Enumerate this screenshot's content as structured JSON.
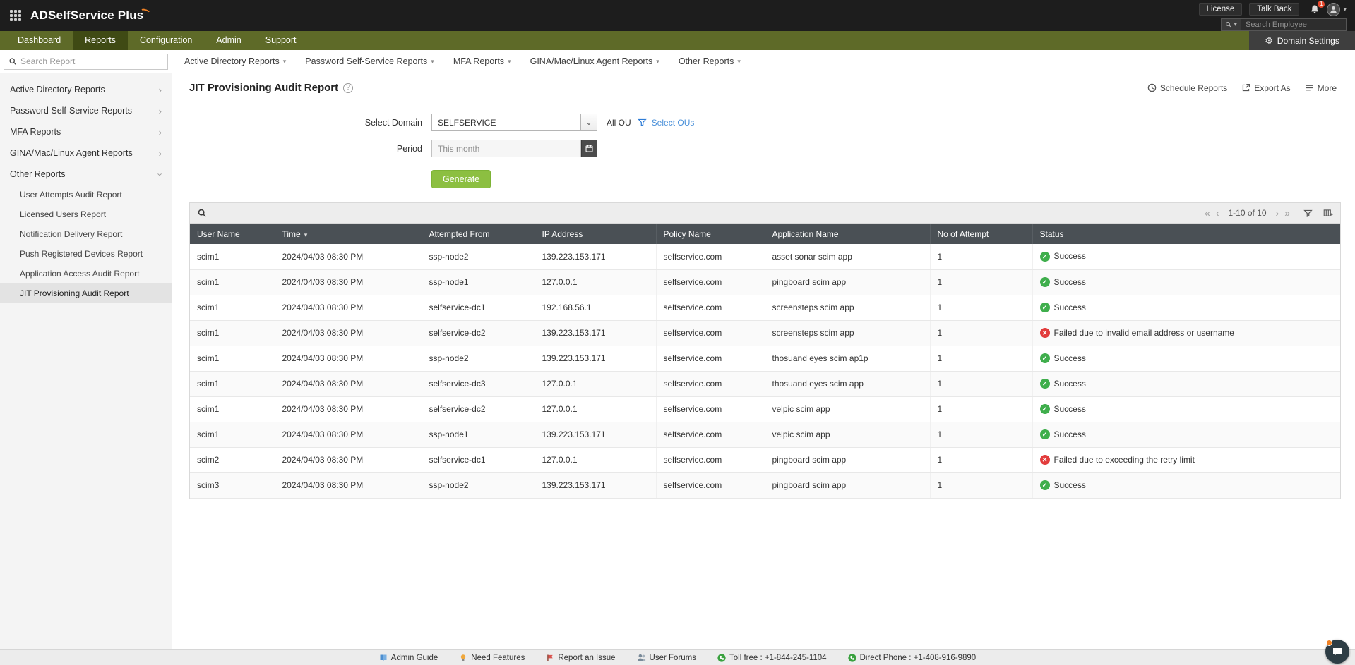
{
  "colors": {
    "header_bg": "#1d1d1d",
    "nav_bar_olive": "#5e6a28",
    "nav_active_tab": "#3f4a14",
    "accent_green": "#8cbf41",
    "link_blue": "#4a90d9",
    "success_green": "#3fae4c",
    "error_red": "#e23c3c",
    "table_header_bg": "#4a5055",
    "logo_swoosh_orange": "#f08124"
  },
  "header": {
    "app_title": "ADSelfService Plus",
    "license_label": "License",
    "talkback_label": "Talk Back",
    "notification_count": "1",
    "employee_search_placeholder": "Search Employee"
  },
  "nav": {
    "tabs": [
      {
        "label": "Dashboard",
        "active": false
      },
      {
        "label": "Reports",
        "active": true
      },
      {
        "label": "Configuration",
        "active": false
      },
      {
        "label": "Admin",
        "active": false
      },
      {
        "label": "Support",
        "active": false
      }
    ],
    "domain_settings_label": "Domain Settings"
  },
  "subnav": {
    "report_search_placeholder": "Search Report",
    "menus": [
      {
        "label": "Active Directory Reports"
      },
      {
        "label": "Password Self-Service Reports"
      },
      {
        "label": "MFA Reports"
      },
      {
        "label": "GINA/Mac/Linux Agent Reports"
      },
      {
        "label": "Other Reports"
      }
    ]
  },
  "sidebar": {
    "groups": [
      {
        "label": "Active Directory Reports",
        "expanded": false
      },
      {
        "label": "Password Self-Service Reports",
        "expanded": false
      },
      {
        "label": "MFA Reports",
        "expanded": false
      },
      {
        "label": "GINA/Mac/Linux Agent Reports",
        "expanded": false
      },
      {
        "label": "Other Reports",
        "expanded": true,
        "items": [
          {
            "label": "User Attempts Audit Report",
            "selected": false
          },
          {
            "label": "Licensed Users Report",
            "selected": false
          },
          {
            "label": "Notification Delivery Report",
            "selected": false
          },
          {
            "label": "Push Registered Devices Report",
            "selected": false
          },
          {
            "label": "Application Access Audit Report",
            "selected": false
          },
          {
            "label": "JIT Provisioning Audit Report",
            "selected": true
          }
        ]
      }
    ]
  },
  "page": {
    "title": "JIT Provisioning Audit Report",
    "actions": [
      {
        "label": "Schedule Reports",
        "icon": "schedule-icon"
      },
      {
        "label": "Export As",
        "icon": "export-icon"
      },
      {
        "label": "More",
        "icon": "more-icon"
      }
    ]
  },
  "filters": {
    "domain_label": "Select Domain",
    "domain_value": "SELFSERVICE",
    "ou_scope_label": "All OU",
    "select_ous_label": "Select OUs",
    "period_label": "Period",
    "period_value": "This month",
    "generate_label": "Generate"
  },
  "table": {
    "pagination": "1-10 of 10",
    "sorted_column": "Time",
    "columns": [
      "User Name",
      "Time",
      "Attempted From",
      "IP Address",
      "Policy Name",
      "Application Name",
      "No of Attempt",
      "Status"
    ],
    "rows": [
      {
        "user": "scim1",
        "time": "2024/04/03 08:30 PM",
        "from": "ssp-node2",
        "ip": "139.223.153.171",
        "policy": "selfservice.com",
        "app": "asset sonar scim app",
        "attempts": "1",
        "status": "Success",
        "ok": true
      },
      {
        "user": "scim1",
        "time": "2024/04/03 08:30 PM",
        "from": "ssp-node1",
        "ip": "127.0.0.1",
        "policy": "selfservice.com",
        "app": "pingboard scim app",
        "attempts": "1",
        "status": "Success",
        "ok": true
      },
      {
        "user": "scim1",
        "time": "2024/04/03 08:30 PM",
        "from": "selfservice-dc1",
        "ip": "192.168.56.1",
        "policy": "selfservice.com",
        "app": "screensteps scim app",
        "attempts": "1",
        "status": "Success",
        "ok": true
      },
      {
        "user": "scim1",
        "time": "2024/04/03 08:30 PM",
        "from": "selfservice-dc2",
        "ip": "139.223.153.171",
        "policy": "selfservice.com",
        "app": "screensteps scim app",
        "attempts": "1",
        "status": "Failed due to invalid email address or username",
        "ok": false
      },
      {
        "user": "scim1",
        "time": "2024/04/03 08:30 PM",
        "from": "ssp-node2",
        "ip": "139.223.153.171",
        "policy": "selfservice.com",
        "app": "thosuand eyes scim ap1p",
        "attempts": "1",
        "status": "Success",
        "ok": true
      },
      {
        "user": "scim1",
        "time": "2024/04/03 08:30 PM",
        "from": "selfservice-dc3",
        "ip": "127.0.0.1",
        "policy": "selfservice.com",
        "app": "thosuand eyes scim app",
        "attempts": "1",
        "status": "Success",
        "ok": true
      },
      {
        "user": "scim1",
        "time": "2024/04/03 08:30 PM",
        "from": "selfservice-dc2",
        "ip": "127.0.0.1",
        "policy": "selfservice.com",
        "app": "velpic scim app",
        "attempts": "1",
        "status": "Success",
        "ok": true
      },
      {
        "user": "scim1",
        "time": "2024/04/03 08:30 PM",
        "from": "ssp-node1",
        "ip": "139.223.153.171",
        "policy": "selfservice.com",
        "app": "velpic scim app",
        "attempts": "1",
        "status": "Success",
        "ok": true
      },
      {
        "user": "scim2",
        "time": "2024/04/03 08:30 PM",
        "from": "selfservice-dc1",
        "ip": "127.0.0.1",
        "policy": "selfservice.com",
        "app": "pingboard scim app",
        "attempts": "1",
        "status": "Failed due to exceeding the retry limit",
        "ok": false
      },
      {
        "user": "scim3",
        "time": "2024/04/03 08:30 PM",
        "from": "ssp-node2",
        "ip": "139.223.153.171",
        "policy": "selfservice.com",
        "app": "pingboard scim app",
        "attempts": "1",
        "status": "Success",
        "ok": true
      }
    ]
  },
  "footer": {
    "links": [
      {
        "label": "Admin Guide",
        "icon": "book-icon"
      },
      {
        "label": "Need Features",
        "icon": "bulb-icon"
      },
      {
        "label": "Report an Issue",
        "icon": "issue-icon"
      },
      {
        "label": "User Forums",
        "icon": "forum-icon"
      },
      {
        "label": "Toll free : +1-844-245-1104",
        "icon": "phone-icon"
      },
      {
        "label": "Direct Phone : +1-408-916-9890",
        "icon": "phone-icon"
      }
    ]
  }
}
